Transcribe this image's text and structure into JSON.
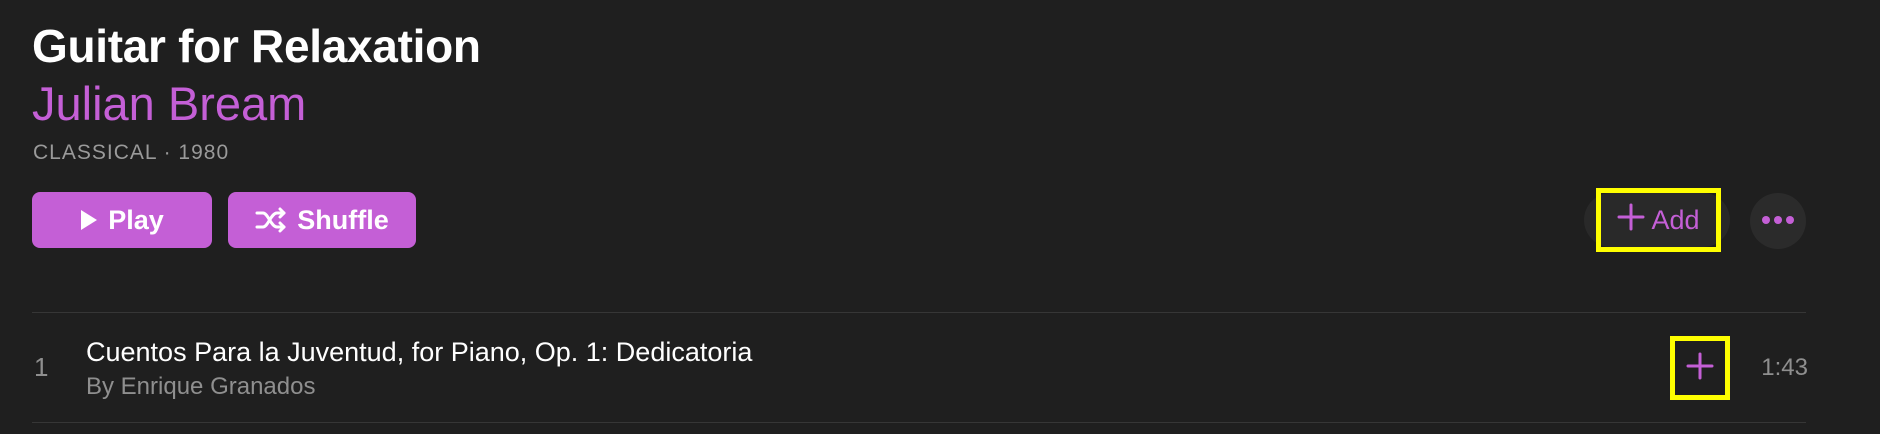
{
  "album": {
    "title": "Guitar for Relaxation",
    "artist": "Julian Bream",
    "meta": "CLASSICAL · 1980"
  },
  "actions": {
    "play_label": "Play",
    "shuffle_label": "Shuffle",
    "add_label": "Add"
  },
  "tracks": [
    {
      "number": "1",
      "title": "Cuentos Para la Juventud, for Piano, Op. 1: Dedicatoria",
      "artist": "By Enrique Granados",
      "duration": "1:43"
    }
  ],
  "colors": {
    "accent": "#c45fd6",
    "background": "#1f1f1f",
    "highlight": "#ffff00"
  },
  "icons": {
    "play": "play-icon",
    "shuffle": "shuffle-icon",
    "add": "plus-icon",
    "more": "ellipsis-icon"
  }
}
